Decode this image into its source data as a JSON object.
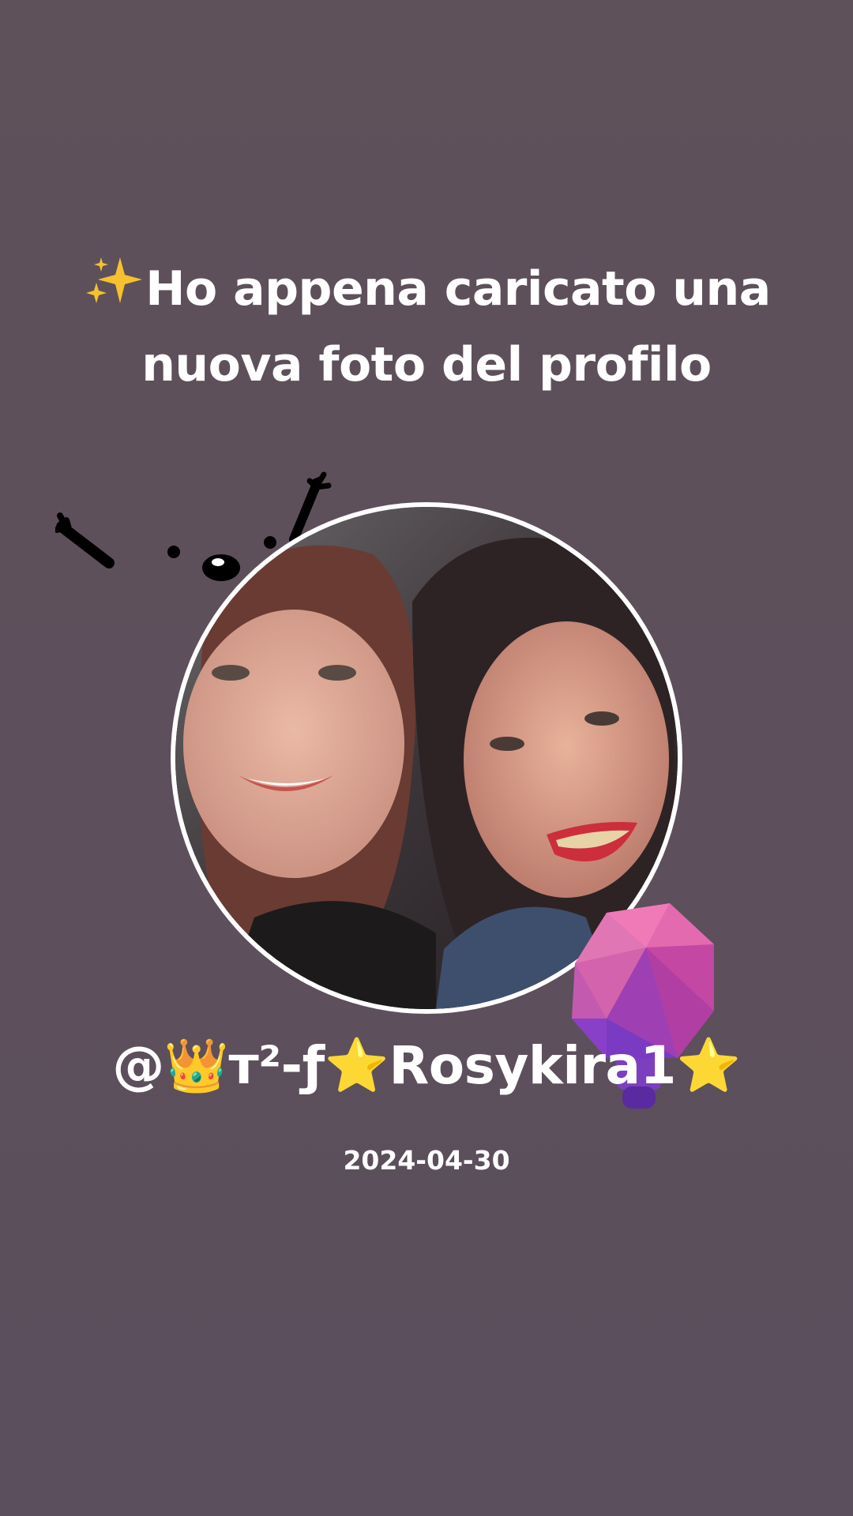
{
  "headline": {
    "emoji": "✨",
    "line1": "Ho appena caricato una",
    "line2": "nuova foto del profilo"
  },
  "profile": {
    "username": "@👑ᴛ²-ƒ⭐Rosykira1⭐",
    "date": "2024-04-30"
  },
  "icons": {
    "sparkle": "sparkles-icon",
    "doodle": "cute-face-doodle",
    "mic": "microphone-icon"
  },
  "colors": {
    "background": "#5e505c",
    "text": "#ffffff",
    "ring": "#ffffff",
    "mic_pink": "#e45fb4",
    "mic_purple": "#8a3fc8"
  }
}
